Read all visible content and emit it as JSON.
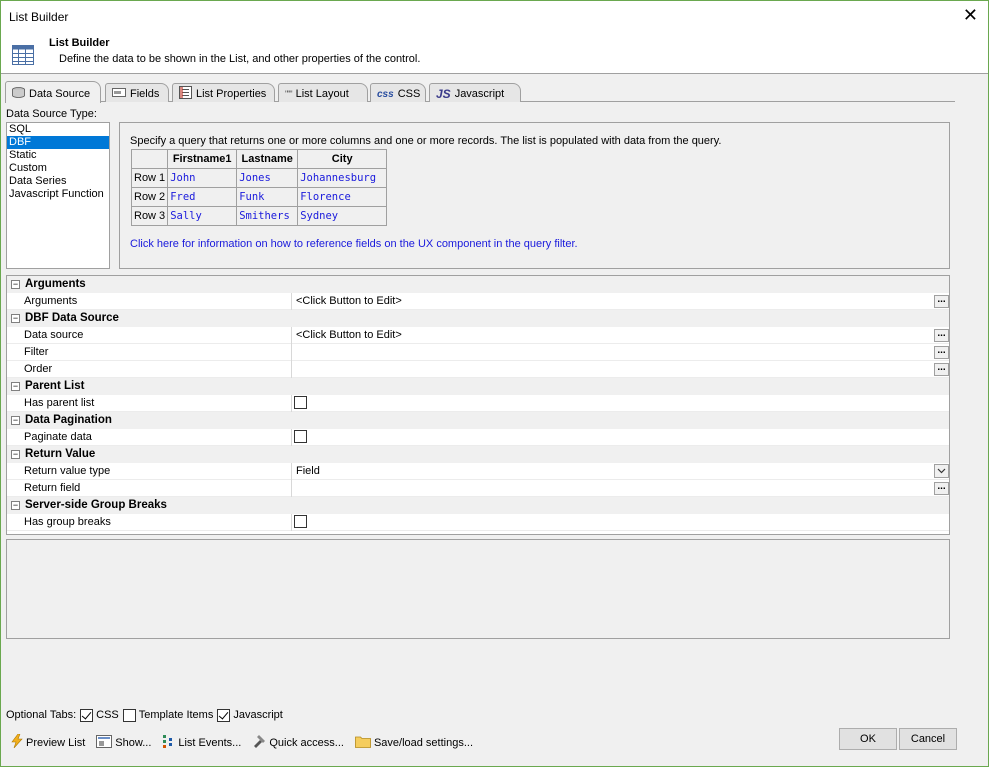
{
  "window": {
    "title": "List Builder",
    "close_glyph": "✕"
  },
  "header": {
    "title": "List Builder",
    "description": "Define the data to be shown in the List, and other properties of the control.",
    "icon": "list-builder-icon"
  },
  "tabs": [
    {
      "label": "Data Source",
      "icon": "database-icon",
      "active": true
    },
    {
      "label": "Fields",
      "icon": "field-icon",
      "active": false
    },
    {
      "label": "List Properties",
      "icon": "properties-icon",
      "active": false
    },
    {
      "label": "List Layout",
      "icon": "layout-icon",
      "active": false
    },
    {
      "label": "CSS",
      "icon": "css-icon",
      "active": false
    },
    {
      "label": "Javascript",
      "icon": "js-icon",
      "active": false
    }
  ],
  "tab_icon_text": {
    "layout": "\"\"\"",
    "css": "css",
    "js": "JS"
  },
  "data_source": {
    "label": "Data Source Type:",
    "types": [
      "SQL",
      "DBF",
      "Static",
      "Custom",
      "Data Series",
      "Javascript Function"
    ],
    "selected": "DBF"
  },
  "info": {
    "text": "Specify a query that returns one or more columns and one or more records. The list is populated with data from the query.",
    "link": "Click here for information on how to reference fields on the UX component in the query filter.",
    "table": {
      "headers": [
        "",
        "Firstname1",
        "Lastname",
        "City"
      ],
      "rows": [
        [
          "Row 1",
          "John",
          "Jones",
          "Johannesburg"
        ],
        [
          "Row 2",
          "Fred",
          "Funk",
          "Florence"
        ],
        [
          "Row 3",
          "Sally",
          "Smithers",
          "Sydney"
        ]
      ]
    }
  },
  "property_grid": {
    "toggle_glyph": "−",
    "ellipsis_glyph": "...",
    "groups": [
      {
        "name": "Arguments",
        "items": [
          {
            "name": "Arguments",
            "value": "<Click Button to Edit>",
            "control": "ellipsis"
          }
        ]
      },
      {
        "name": "DBF Data Source",
        "items": [
          {
            "name": "Data source",
            "value": "<Click Button to Edit>",
            "control": "ellipsis"
          },
          {
            "name": "Filter",
            "value": "",
            "control": "ellipsis"
          },
          {
            "name": "Order",
            "value": "",
            "control": "ellipsis"
          }
        ]
      },
      {
        "name": "Parent List",
        "items": [
          {
            "name": "Has parent list",
            "value": "",
            "control": "checkbox"
          }
        ]
      },
      {
        "name": "Data Pagination",
        "items": [
          {
            "name": "Paginate data",
            "value": "",
            "control": "checkbox"
          }
        ]
      },
      {
        "name": "Return Value",
        "items": [
          {
            "name": "Return value type",
            "value": "Field",
            "control": "dropdown"
          },
          {
            "name": "Return field",
            "value": "",
            "control": "ellipsis"
          }
        ]
      },
      {
        "name": "Server-side Group Breaks",
        "items": [
          {
            "name": "Has group breaks",
            "value": "",
            "control": "checkbox"
          }
        ]
      }
    ]
  },
  "optional_tabs": {
    "label": "Optional Tabs:",
    "options": [
      {
        "label": "CSS",
        "checked": true
      },
      {
        "label": "Template Items",
        "checked": false
      },
      {
        "label": "Javascript",
        "checked": true
      }
    ]
  },
  "bottom_buttons": [
    {
      "label": "Preview List",
      "icon": "lightning-icon"
    },
    {
      "label": "Show...",
      "icon": "show-icon"
    },
    {
      "label": "List Events...",
      "icon": "events-icon"
    },
    {
      "label": "Quick access...",
      "icon": "quick-access-icon"
    },
    {
      "label": "Save/load settings...",
      "icon": "folder-icon"
    }
  ],
  "dialog_buttons": {
    "ok": "OK",
    "cancel": "Cancel"
  },
  "colors": {
    "selection": "#0078d7",
    "link": "#1a1adc",
    "window_border": "#6aa84f"
  }
}
